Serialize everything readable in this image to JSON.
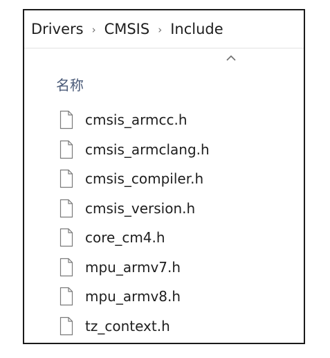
{
  "breadcrumb": {
    "items": [
      "Drivers",
      "CMSIS",
      "Include"
    ],
    "separator": "›"
  },
  "list": {
    "column_header": "名称",
    "sort_icon": "chevron-up-icon",
    "file_icon": "blank-document-icon",
    "files": [
      {
        "name": "cmsis_armcc.h"
      },
      {
        "name": "cmsis_armclang.h"
      },
      {
        "name": "cmsis_compiler.h"
      },
      {
        "name": "cmsis_version.h"
      },
      {
        "name": "core_cm4.h"
      },
      {
        "name": "mpu_armv7.h"
      },
      {
        "name": "mpu_armv8.h"
      },
      {
        "name": "tz_context.h"
      }
    ]
  },
  "colors": {
    "border": "#1a1a1a",
    "text": "#1e1e1e",
    "header_text": "#4a5a78",
    "icon_stroke": "#7a7a7a"
  }
}
